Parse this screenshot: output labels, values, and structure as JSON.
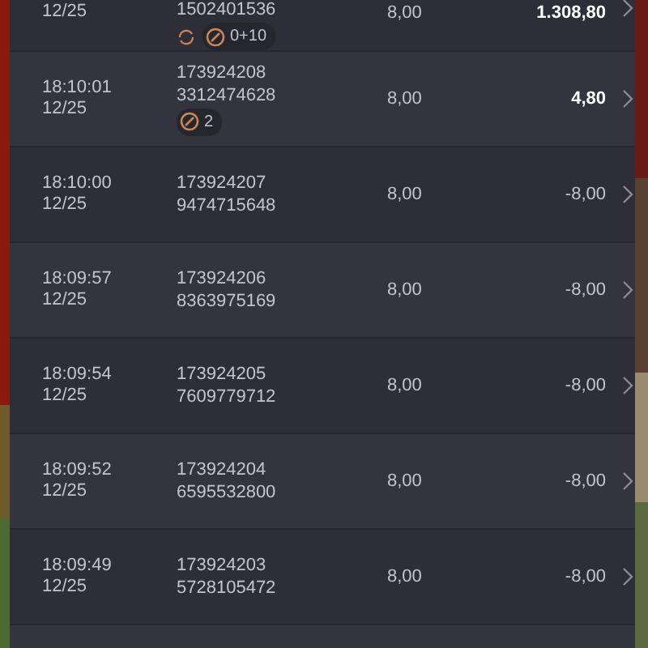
{
  "rows": [
    {
      "kind": "partial",
      "date": "12/25",
      "id_lines": [
        "1502401536"
      ],
      "bet": "8,00",
      "result": "1.308,80",
      "positive": true,
      "badges": [
        {
          "kind": "spin"
        },
        {
          "kind": "bonus",
          "text": "0+10"
        }
      ]
    },
    {
      "kind": "full",
      "time": "18:10:01",
      "date": "12/25",
      "id_lines": [
        "173924208",
        "3312474628"
      ],
      "bet": "8,00",
      "result": "4,80",
      "positive": true,
      "badges": [
        {
          "kind": "bonus",
          "text": "2"
        }
      ]
    },
    {
      "kind": "full",
      "time": "18:10:00",
      "date": "12/25",
      "id_lines": [
        "173924207",
        "9474715648"
      ],
      "bet": "8,00",
      "result": "-8,00",
      "positive": false,
      "badges": []
    },
    {
      "kind": "full",
      "time": "18:09:57",
      "date": "12/25",
      "id_lines": [
        "173924206",
        "8363975169"
      ],
      "bet": "8,00",
      "result": "-8,00",
      "positive": false,
      "badges": []
    },
    {
      "kind": "full",
      "time": "18:09:54",
      "date": "12/25",
      "id_lines": [
        "173924205",
        "7609779712"
      ],
      "bet": "8,00",
      "result": "-8,00",
      "positive": false,
      "badges": []
    },
    {
      "kind": "full",
      "time": "18:09:52",
      "date": "12/25",
      "id_lines": [
        "173924204",
        "6595532800"
      ],
      "bet": "8,00",
      "result": "-8,00",
      "positive": false,
      "badges": []
    },
    {
      "kind": "full",
      "time": "18:09:49",
      "date": "12/25",
      "id_lines": [
        "173924203",
        "5728105472"
      ],
      "bet": "8,00",
      "result": "-8,00",
      "positive": false,
      "badges": []
    },
    {
      "kind": "empty"
    }
  ]
}
